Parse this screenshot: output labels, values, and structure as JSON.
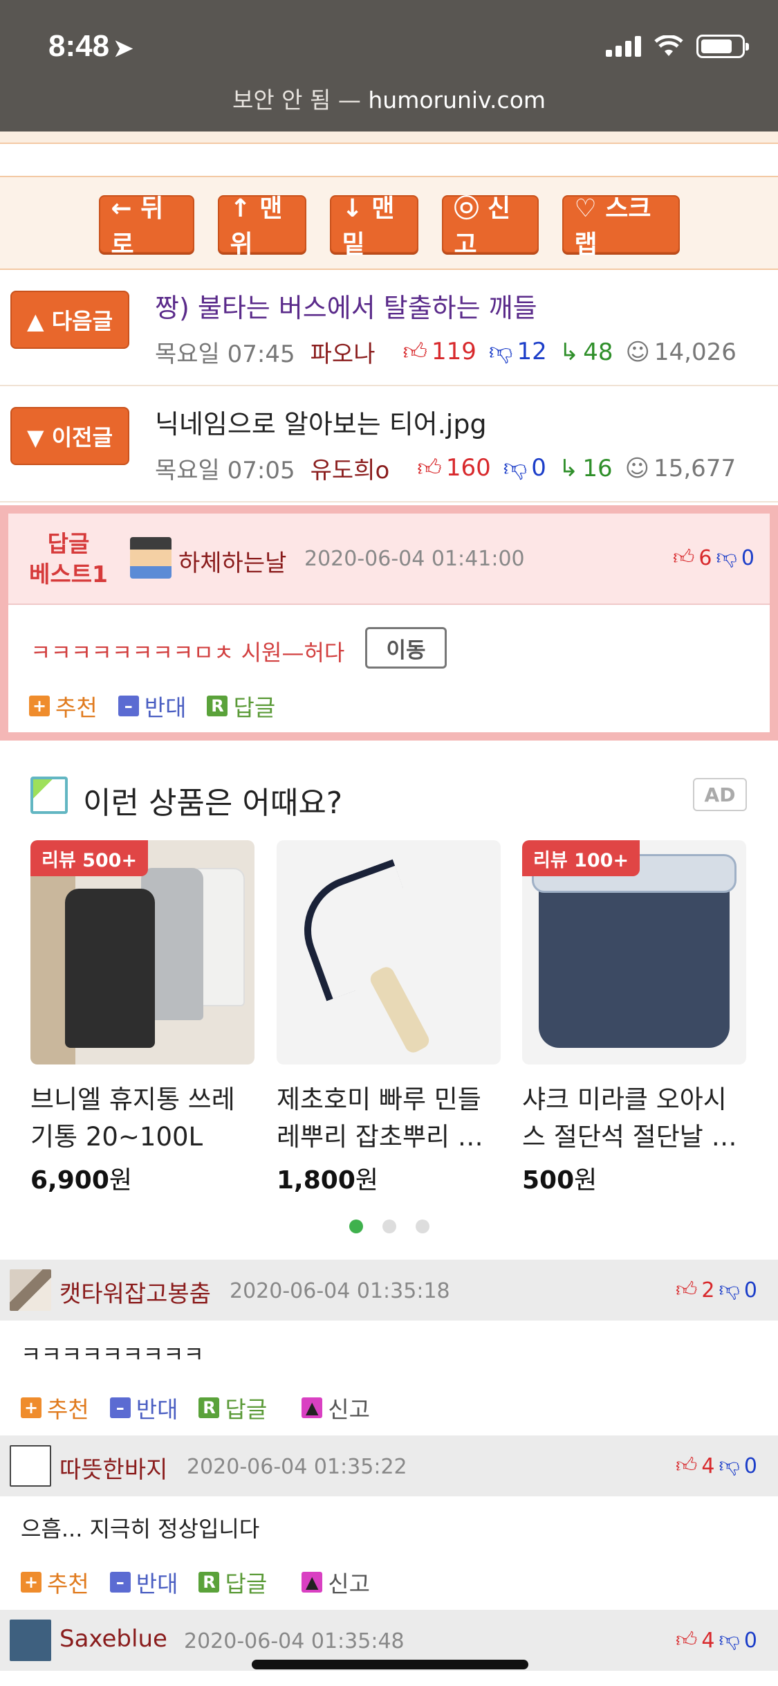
{
  "status": {
    "time": "8:48",
    "url_prefix": "보안 안 됨 — ",
    "url_domain": "humoruniv.com"
  },
  "nav": [
    "← 뒤로",
    "↑ 맨위",
    "↓ 맨밑",
    "㉧ 신고",
    "♡ 스크랩"
  ],
  "next_post": {
    "tag": "▲ 다음글",
    "title": "짱) 불타는 버스에서 탈출하는 깨들",
    "time": "목요일 07:45",
    "author": "파오나",
    "up": "119",
    "down": "12",
    "replies": "48",
    "views": "14,026"
  },
  "prev_post": {
    "tag": "▼ 이전글",
    "title": "닉네임으로 알아보는 티어.jpg",
    "time": "목요일 07:05",
    "author": "유도희o",
    "up": "160",
    "down": "0",
    "replies": "16",
    "views": "15,677"
  },
  "best": {
    "label1": "답글",
    "label2": "베스트1",
    "name": "하체하는날",
    "date": "2020-06-04 01:41:00",
    "up": "6",
    "down": "0",
    "text": "ㅋㅋㅋㅋㅋㅋㅋㅋㅁㅊ 시원—허다",
    "move": "이동"
  },
  "actions": {
    "recommend": "추천",
    "oppose": "반대",
    "reply": "답글",
    "report": "신고"
  },
  "ad": {
    "title": "이런 상품은 어때요?",
    "badge": "AD",
    "products": [
      {
        "badge": "리뷰 500+",
        "name": "브니엘 휴지통 쓰레기통 20~100L",
        "price": "6,900",
        "unit": "원"
      },
      {
        "badge": "",
        "name": "제초호미 빠루 민들레뿌리 잡초뿌리 …",
        "price": "1,800",
        "unit": "원"
      },
      {
        "badge": "리뷰 100+",
        "name": "샤크 미라클 오아시스 절단석 절단날 …",
        "price": "500",
        "unit": "원"
      }
    ]
  },
  "comments": [
    {
      "name": "캣타워잡고봉춤",
      "date": "2020-06-04 01:35:18",
      "up": "2",
      "down": "0",
      "text": "ㅋㅋㅋㅋㅋㅋㅋㅋㅋ"
    },
    {
      "name": "따뜻한바지",
      "date": "2020-06-04 01:35:22",
      "up": "4",
      "down": "0",
      "text": "으흠... 지극히 정상입니다"
    },
    {
      "name": "Saxeblue",
      "date": "2020-06-04 01:35:48",
      "up": "4",
      "down": "0",
      "text": ""
    }
  ],
  "icons": {
    "thumb_up": "thumb-up-icon",
    "thumb_down": "thumb-down-icon",
    "reply": "reply-arrow-icon",
    "views": "smiley-icon"
  },
  "colors": {
    "accent": "#e8672c",
    "best_border": "#f4b7b6",
    "up": "#d8292c",
    "down": "#1c3ec9"
  }
}
